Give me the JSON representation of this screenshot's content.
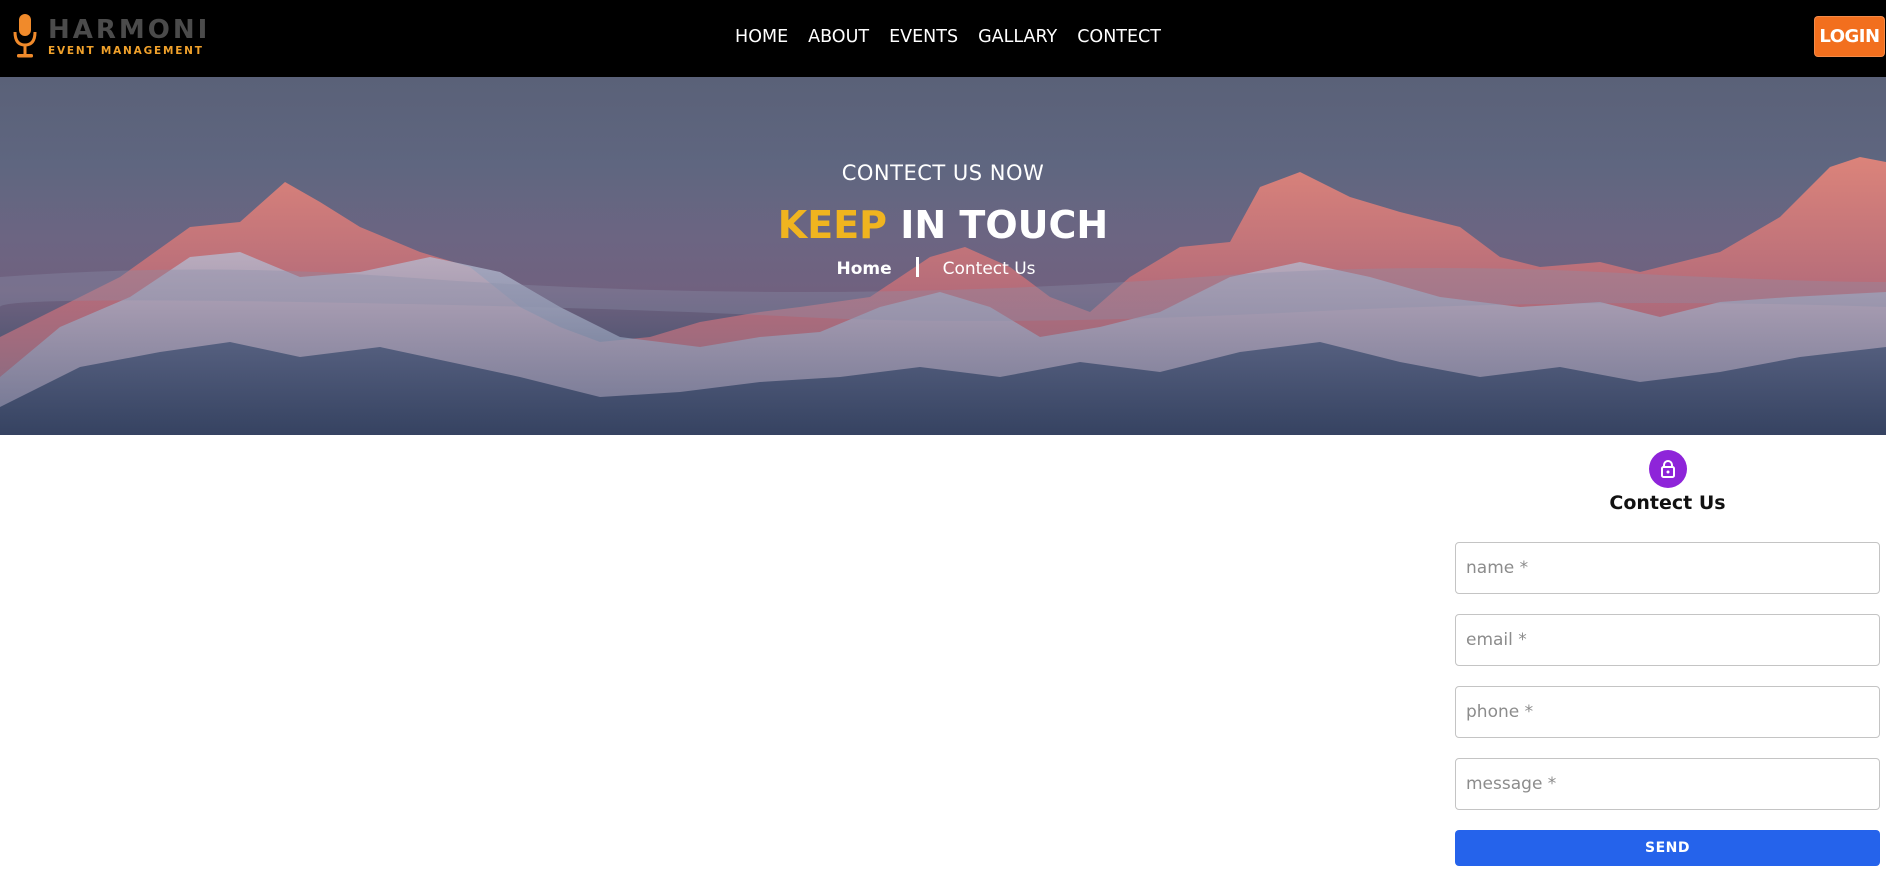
{
  "brand": {
    "name": "HARMONI",
    "tagline": "EVENT MANAGEMENT",
    "accent_color": "#f0a12b",
    "icon": "microphone-icon"
  },
  "nav": {
    "items": [
      "HOME",
      "ABOUT",
      "EVENTS",
      "GALLARY",
      "CONTECT"
    ]
  },
  "login": {
    "label": "LOGIN",
    "color": "#f26f1e"
  },
  "hero": {
    "subtitle": "CONTECT US NOW",
    "title_accent": "KEEP",
    "title_rest": "IN TOUCH",
    "accent_color": "#f0b41f",
    "breadcrumb": {
      "home": "Home",
      "current": "Contect Us"
    }
  },
  "form": {
    "icon": "lock-icon",
    "icon_color": "#8e24d9",
    "title": "Contect Us",
    "fields": [
      {
        "placeholder": "name *"
      },
      {
        "placeholder": "email *"
      },
      {
        "placeholder": "phone *"
      },
      {
        "placeholder": "message *"
      }
    ],
    "submit_label": "SEND",
    "submit_color": "#2563eb"
  }
}
